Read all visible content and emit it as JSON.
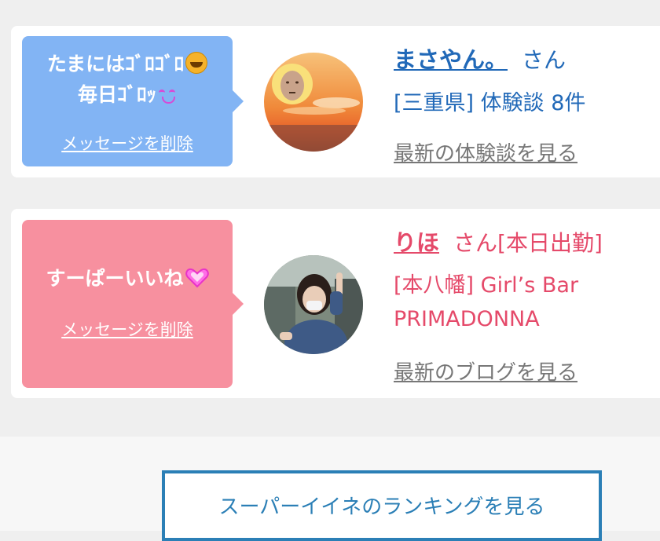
{
  "cards": [
    {
      "message_lines": [
        "たまにはｺﾞﾛｺﾞﾛ",
        "毎日ｺﾞﾛｯ"
      ],
      "delete_label": "メッセージを削除",
      "name": "まさやん。",
      "honorific": "さん",
      "detail_line1": "[三重県] 体験談 8件",
      "latest_link": "最新の体験談を見る",
      "bubble_color": "#82b4f4",
      "accent_color": "#2169b8"
    },
    {
      "message_lines": [
        "すーぱーいいね"
      ],
      "delete_label": "メッセージを削除",
      "name": "りほ",
      "honorific": "さん[本日出勤]",
      "detail_line1": "[本八幡] Girl’s Bar",
      "detail_line2": "PRIMADONNA",
      "latest_link": "最新のブログを見る",
      "bubble_color": "#f7909f",
      "accent_color": "#e54a6a"
    }
  ],
  "ranking_button_label": "スーパーイイネのランキングを見る"
}
